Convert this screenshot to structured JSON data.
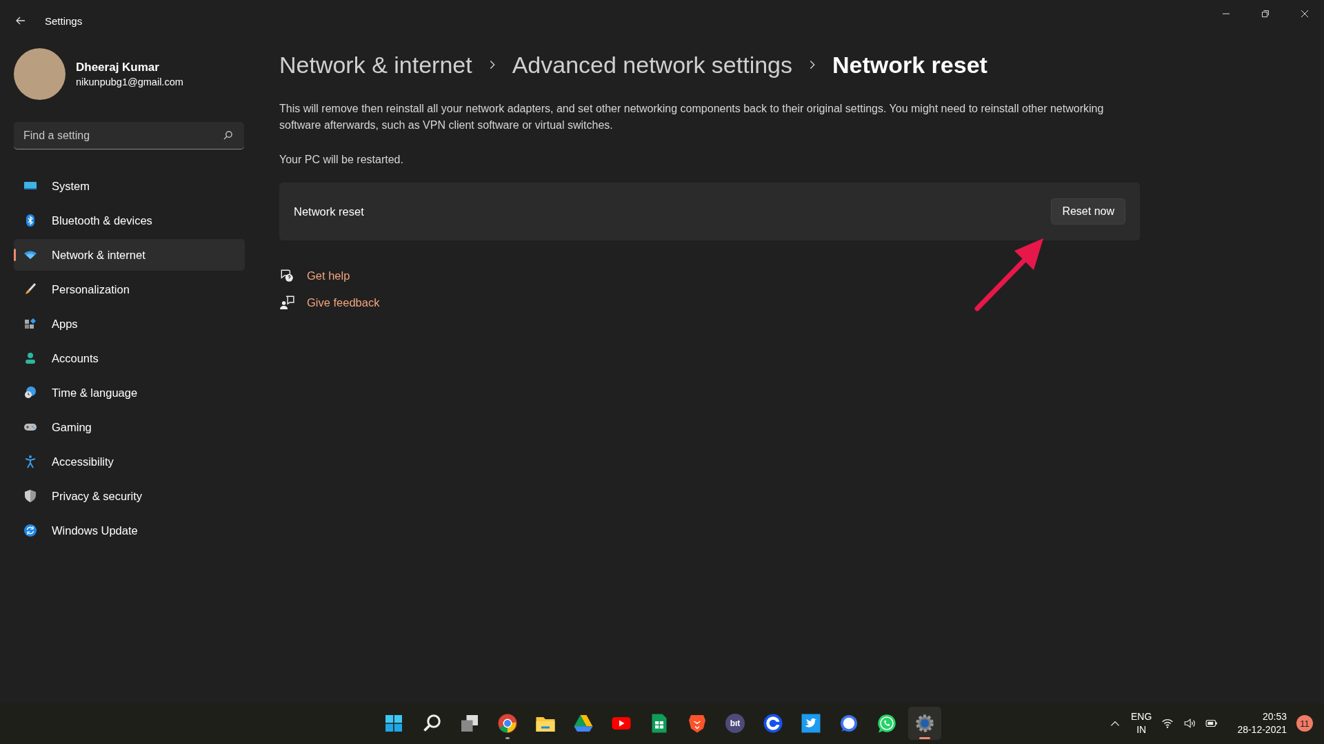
{
  "window": {
    "title": "Settings"
  },
  "user": {
    "name": "Dheeraj Kumar",
    "email": "nikunpubg1@gmail.com"
  },
  "search": {
    "placeholder": "Find a setting"
  },
  "sidebar": {
    "items": [
      {
        "label": "System",
        "kind": "system",
        "selected": false
      },
      {
        "label": "Bluetooth & devices",
        "kind": "bluetooth",
        "selected": false
      },
      {
        "label": "Network & internet",
        "kind": "network",
        "selected": true
      },
      {
        "label": "Personalization",
        "kind": "brush",
        "selected": false
      },
      {
        "label": "Apps",
        "kind": "apps",
        "selected": false
      },
      {
        "label": "Accounts",
        "kind": "accounts",
        "selected": false
      },
      {
        "label": "Time & language",
        "kind": "time",
        "selected": false
      },
      {
        "label": "Gaming",
        "kind": "gaming",
        "selected": false
      },
      {
        "label": "Accessibility",
        "kind": "accessibility",
        "selected": false
      },
      {
        "label": "Privacy & security",
        "kind": "privacy",
        "selected": false
      },
      {
        "label": "Windows Update",
        "kind": "update",
        "selected": false
      }
    ]
  },
  "breadcrumb": [
    {
      "label": "Network & internet",
      "current": false
    },
    {
      "label": "Advanced network settings",
      "current": false
    },
    {
      "label": "Network reset",
      "current": true
    }
  ],
  "description": "This will remove then reinstall all your network adapters, and set other networking components back to their original settings. You might need to reinstall other networking software afterwards, such as VPN client software or virtual switches.",
  "note": "Your PC will be restarted.",
  "card": {
    "label": "Network reset",
    "button": "Reset now"
  },
  "links": [
    {
      "label": "Get help",
      "kind": "help"
    },
    {
      "label": "Give feedback",
      "kind": "feedback"
    }
  ],
  "taskbar": {
    "apps": [
      {
        "kind": "start",
        "running": false,
        "active": false
      },
      {
        "kind": "search",
        "running": false,
        "active": false
      },
      {
        "kind": "taskview",
        "running": false,
        "active": false
      },
      {
        "kind": "browser",
        "running": true,
        "active": false
      },
      {
        "kind": "folder",
        "running": false,
        "active": false
      },
      {
        "kind": "drive",
        "running": false,
        "active": false
      },
      {
        "kind": "video",
        "running": false,
        "active": false
      },
      {
        "kind": "sheets",
        "running": false,
        "active": false
      },
      {
        "kind": "lion",
        "running": false,
        "active": false
      },
      {
        "kind": "bit",
        "label": "bıt",
        "running": false,
        "active": false
      },
      {
        "kind": "ring",
        "running": false,
        "active": false
      },
      {
        "kind": "bird",
        "running": false,
        "active": false
      },
      {
        "kind": "chat",
        "running": false,
        "active": false
      },
      {
        "kind": "phone",
        "running": false,
        "active": false
      },
      {
        "kind": "settings",
        "running": true,
        "active": true
      }
    ],
    "language": "ENG",
    "region": "IN",
    "time": "20:53",
    "date": "28-12-2021",
    "notifications": "11"
  }
}
